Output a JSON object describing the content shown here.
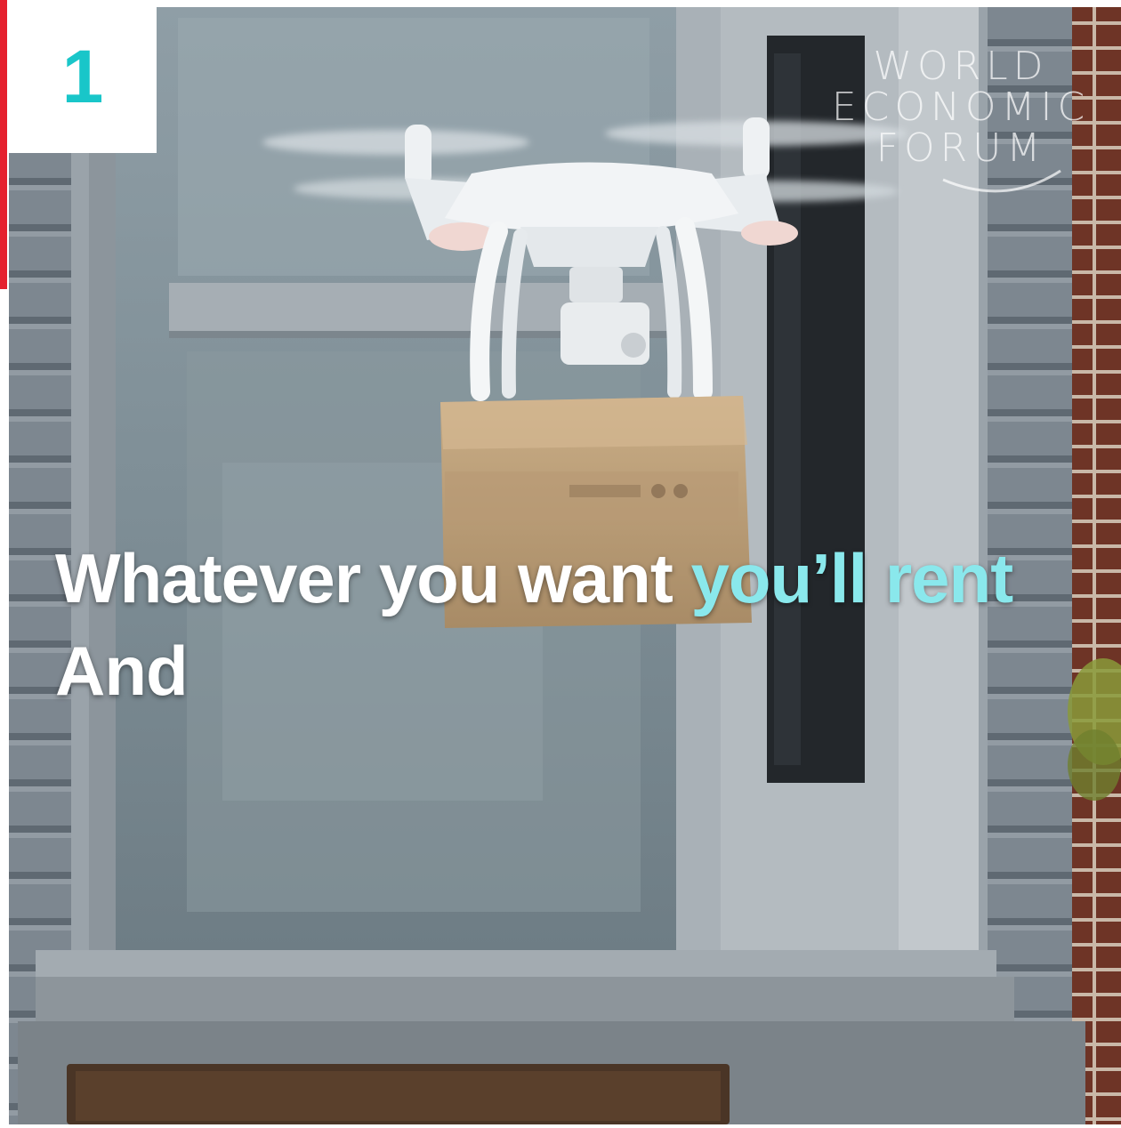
{
  "badge": {
    "number": "1",
    "number_color": "#19c6c9",
    "accent_color": "#e5202e"
  },
  "logo": {
    "lines": [
      "WORLD",
      "ECONOMIC",
      "FORUM"
    ]
  },
  "caption": {
    "line1_white": "Whatever you want ",
    "line1_highlight": "you’ll rent",
    "line2": "And",
    "highlight_color": "#8ae8ec"
  },
  "scene": {
    "subject": "drone-carrying-cardboard-package",
    "setting": "front-door-with-siding-and-brick"
  }
}
